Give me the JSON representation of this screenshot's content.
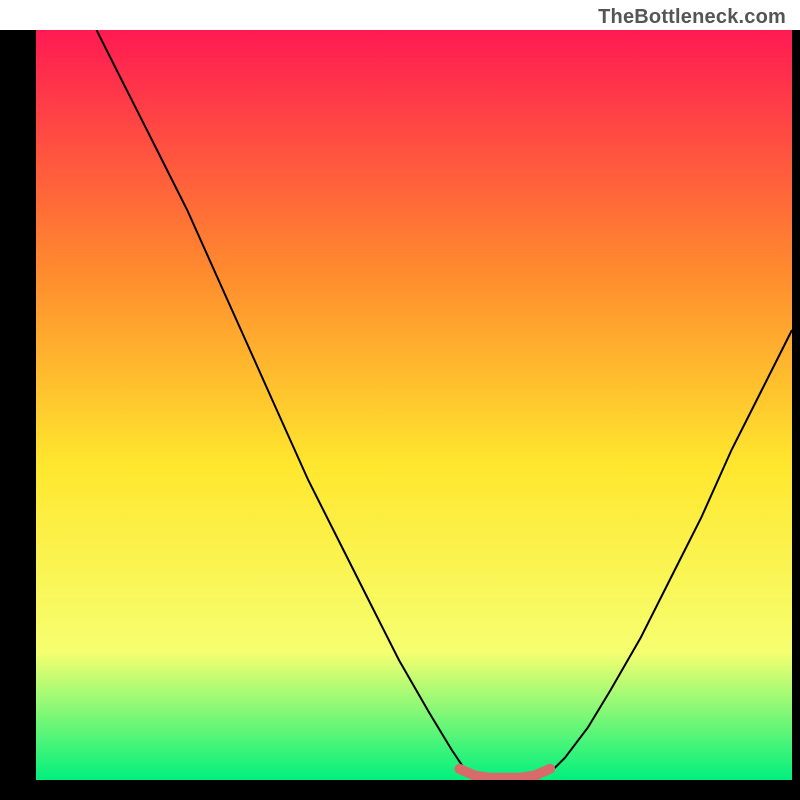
{
  "watermark": "TheBottleneck.com",
  "colors": {
    "gradient_top": "#ff1a52",
    "gradient_mid1": "#ff8a2e",
    "gradient_mid2": "#ffe72e",
    "gradient_mid3": "#f6ff70",
    "gradient_bottom": "#00f07d",
    "frame": "#000000",
    "curve": "#000000",
    "highlight": "#d96a6a"
  },
  "chart_data": {
    "type": "line",
    "title": "",
    "xlabel": "",
    "ylabel": "",
    "xlim": [
      0,
      100
    ],
    "ylim": [
      0,
      100
    ],
    "series": [
      {
        "name": "left-curve",
        "x": [
          8,
          12,
          16,
          20,
          24,
          28,
          32,
          36,
          40,
          44,
          48,
          52,
          55,
          57
        ],
        "values": [
          100,
          92,
          84,
          76,
          67,
          58,
          49,
          40,
          32,
          24,
          16,
          9,
          4,
          1
        ]
      },
      {
        "name": "right-curve",
        "x": [
          68,
          70,
          73,
          76,
          80,
          84,
          88,
          92,
          96,
          100
        ],
        "values": [
          1,
          3,
          7,
          12,
          19,
          27,
          35,
          44,
          52,
          60
        ]
      },
      {
        "name": "bottom-highlight",
        "x": [
          56,
          58,
          60,
          62,
          64,
          66,
          68
        ],
        "values": [
          1.5,
          0.6,
          0.3,
          0.3,
          0.3,
          0.6,
          1.5
        ]
      }
    ]
  }
}
